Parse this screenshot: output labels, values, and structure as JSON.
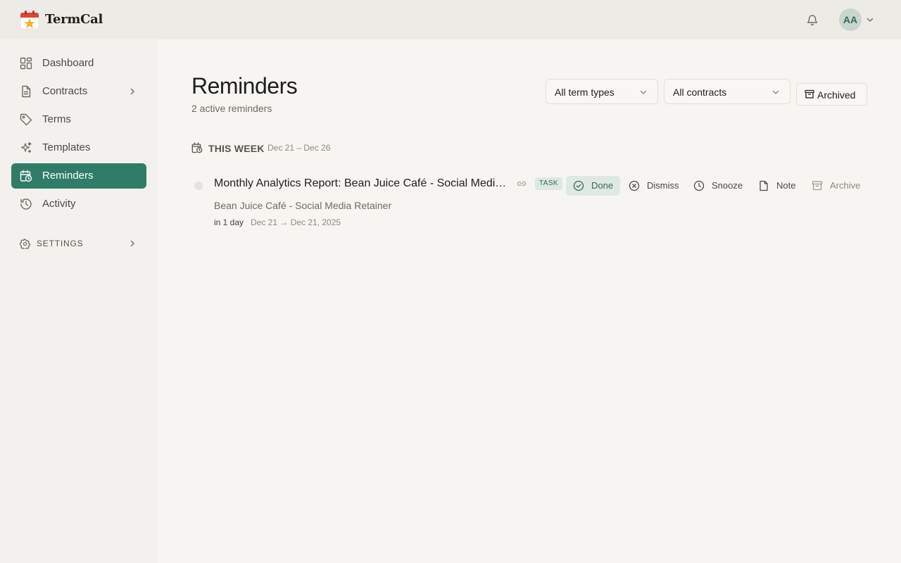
{
  "app": {
    "name": "TermCal"
  },
  "header": {
    "avatar_initials": "AA",
    "notification_icon": "bell-icon"
  },
  "sidebar": {
    "items": [
      {
        "label": "Dashboard",
        "icon": "dashboard-icon"
      },
      {
        "label": "Contracts",
        "icon": "document-icon",
        "expandable": true
      },
      {
        "label": "Terms",
        "icon": "tag-icon"
      },
      {
        "label": "Templates",
        "icon": "sparkles-icon"
      },
      {
        "label": "Reminders",
        "icon": "calendar-clock-icon",
        "active": true
      },
      {
        "label": "Activity",
        "icon": "history-icon"
      }
    ],
    "settings_label": "SETTINGS"
  },
  "page": {
    "title": "Reminders",
    "subtitle": "2 active reminders"
  },
  "filters": {
    "term_type": "All term types",
    "contract": "All contracts",
    "archived_label": "Archived"
  },
  "section": {
    "label": "THIS WEEK",
    "range": "Dec 21 – Dec 26"
  },
  "reminders": [
    {
      "title": "Monthly Analytics Report: Bean Juice Café - Social Media Retainer",
      "badge": "TASK",
      "contract": "Bean Juice Café - Social Media Retainer",
      "due": "in 1 day",
      "dates": "Dec 21 → Dec 21, 2025",
      "actions": {
        "done": "Done",
        "dismiss": "Dismiss",
        "snooze": "Snooze",
        "note": "Note",
        "archive": "Archive"
      }
    }
  ],
  "colors": {
    "accent": "#2f7d66",
    "accent_light": "#dfe8e2",
    "background": "#f6f5f1",
    "sidebar": "#f2f1ed"
  }
}
